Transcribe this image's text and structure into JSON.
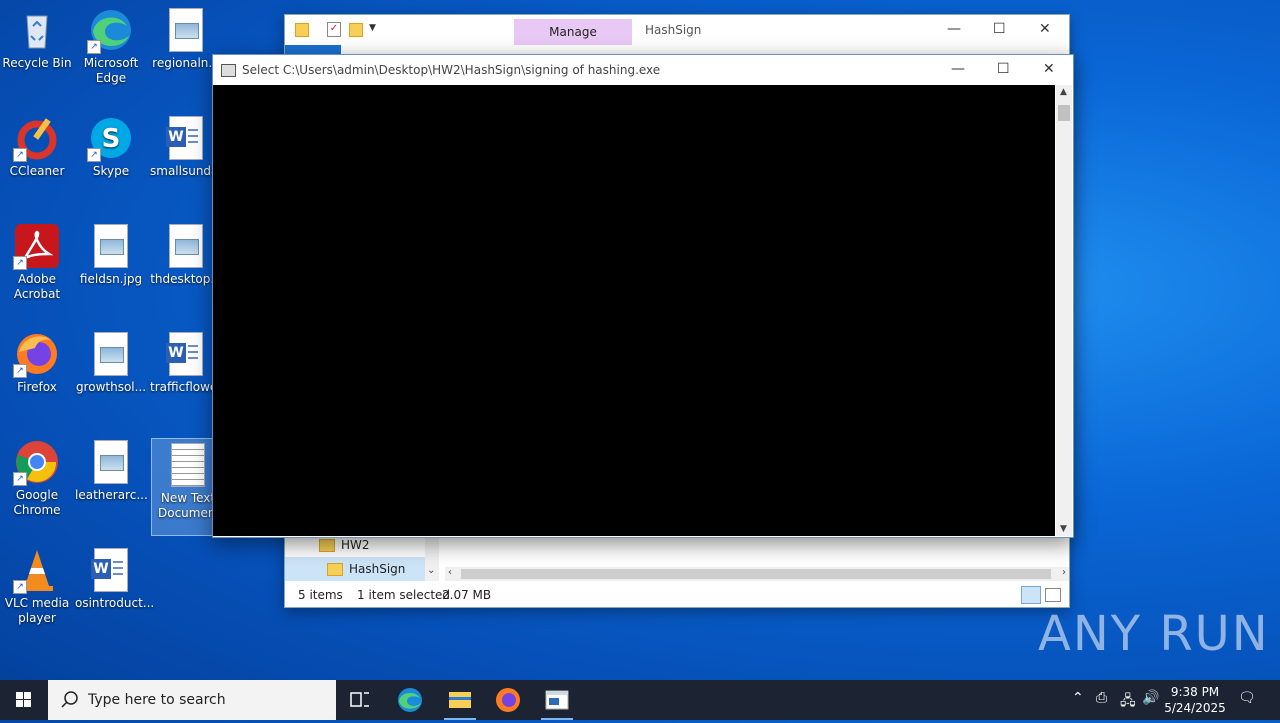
{
  "desktop": {
    "icons": [
      {
        "label": "Recycle Bin"
      },
      {
        "label": "Microsoft Edge"
      },
      {
        "label": "regionaln..."
      },
      {
        "label": "CCleaner"
      },
      {
        "label": "Skype"
      },
      {
        "label": "smallsunda..."
      },
      {
        "label": "Adobe Acrobat"
      },
      {
        "label": "fieldsn.jpg"
      },
      {
        "label": "thdesktop..."
      },
      {
        "label": "Firefox"
      },
      {
        "label": "growthsol..."
      },
      {
        "label": "trafficflowe..."
      },
      {
        "label": "Google Chrome"
      },
      {
        "label": "leatherarc..."
      },
      {
        "label": "New Text Document.t"
      },
      {
        "label": "VLC media player"
      },
      {
        "label": "osintroduct..."
      }
    ]
  },
  "explorer": {
    "manage_tab": "Manage",
    "title": "HashSign",
    "tree": [
      {
        "label": "HW2"
      },
      {
        "label": "HashSign"
      }
    ],
    "status": {
      "items": "5 items",
      "selected": "1 item selected",
      "size": "2.07 MB"
    }
  },
  "console": {
    "title": "Select C:\\Users\\admin\\Desktop\\HW2\\HashSign\\signing of hashing.exe"
  },
  "taskbar": {
    "search_placeholder": "Type here to search",
    "time": "9:38 PM",
    "date": "5/24/2025"
  },
  "watermark": "ANY RUN"
}
